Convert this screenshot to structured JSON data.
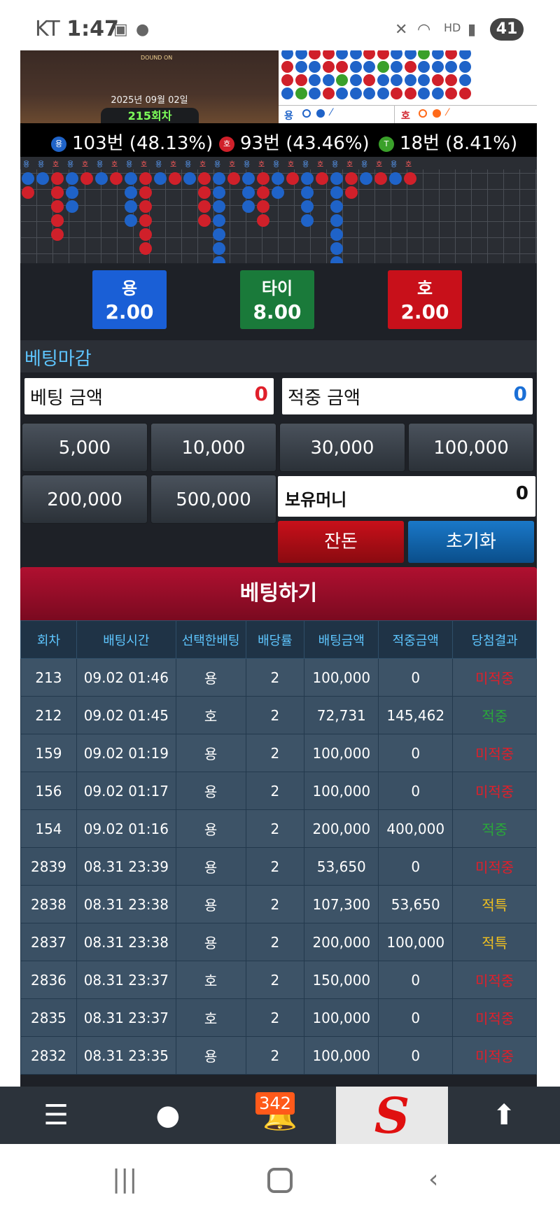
{
  "status": {
    "carrier": "KT",
    "time": "1:47",
    "battery": "41"
  },
  "hero": {
    "date": "2025년 09월 02일",
    "round": "215회차",
    "logo": "DOUND ON"
  },
  "board_legend": {
    "dragon": "용",
    "tiger": "호"
  },
  "stats": [
    {
      "label": "용",
      "text": "103번 (48.13%)",
      "color": "#1f63c8"
    },
    {
      "label": "호",
      "text": "93번 (43.46%)",
      "color": "#d0202a"
    },
    {
      "label": "T",
      "text": "18번 (8.41%)",
      "color": "#3aa02a"
    }
  ],
  "grid_header": [
    "용",
    "용",
    "호",
    "용",
    "호",
    "용",
    "호",
    "용",
    "호",
    "용",
    "호",
    "용",
    "호",
    "용",
    "호",
    "용",
    "호",
    "용",
    "호",
    "용",
    "호",
    "용",
    "호",
    "용",
    "호",
    "용",
    "호"
  ],
  "odds": [
    {
      "name": "용",
      "value": "2.00",
      "color": "#1a5fd6"
    },
    {
      "name": "타이",
      "value": "8.00",
      "color": "#1a7a3a"
    },
    {
      "name": "호",
      "value": "2.00",
      "color": "#c8101a"
    }
  ],
  "closing_label": "베팅마감",
  "bet_amount": {
    "label": "베팅 금액",
    "value": "0"
  },
  "win_amount": {
    "label": "적중 금액",
    "value": "0"
  },
  "chips": [
    "5,000",
    "10,000",
    "30,000",
    "100,000",
    "200,000",
    "500,000"
  ],
  "wallet": {
    "label": "보유머니",
    "value": "0"
  },
  "buttons": {
    "balance": "잔돈",
    "reset": "초기화",
    "bet": "베팅하기"
  },
  "table": {
    "headers": [
      "회차",
      "배팅시간",
      "선택한배팅",
      "배당률",
      "배팅금액",
      "적중금액",
      "당첨결과"
    ],
    "rows": [
      [
        "213",
        "09.02 01:46",
        "용",
        "2",
        "100,000",
        "0",
        "미적중"
      ],
      [
        "212",
        "09.02 01:45",
        "호",
        "2",
        "72,731",
        "145,462",
        "적중"
      ],
      [
        "159",
        "09.02 01:19",
        "용",
        "2",
        "100,000",
        "0",
        "미적중"
      ],
      [
        "156",
        "09.02 01:17",
        "용",
        "2",
        "100,000",
        "0",
        "미적중"
      ],
      [
        "154",
        "09.02 01:16",
        "용",
        "2",
        "200,000",
        "400,000",
        "적중"
      ],
      [
        "2839",
        "08.31 23:39",
        "용",
        "2",
        "53,650",
        "0",
        "미적중"
      ],
      [
        "2838",
        "08.31 23:38",
        "용",
        "2",
        "107,300",
        "53,650",
        "적특"
      ],
      [
        "2837",
        "08.31 23:38",
        "용",
        "2",
        "200,000",
        "100,000",
        "적특"
      ],
      [
        "2836",
        "08.31 23:37",
        "호",
        "2",
        "150,000",
        "0",
        "미적중"
      ],
      [
        "2835",
        "08.31 23:37",
        "호",
        "2",
        "100,000",
        "0",
        "미적중"
      ],
      [
        "2832",
        "08.31 23:35",
        "용",
        "2",
        "100,000",
        "0",
        "미적중"
      ]
    ]
  },
  "nav": {
    "badge": "342",
    "logo": "S"
  }
}
